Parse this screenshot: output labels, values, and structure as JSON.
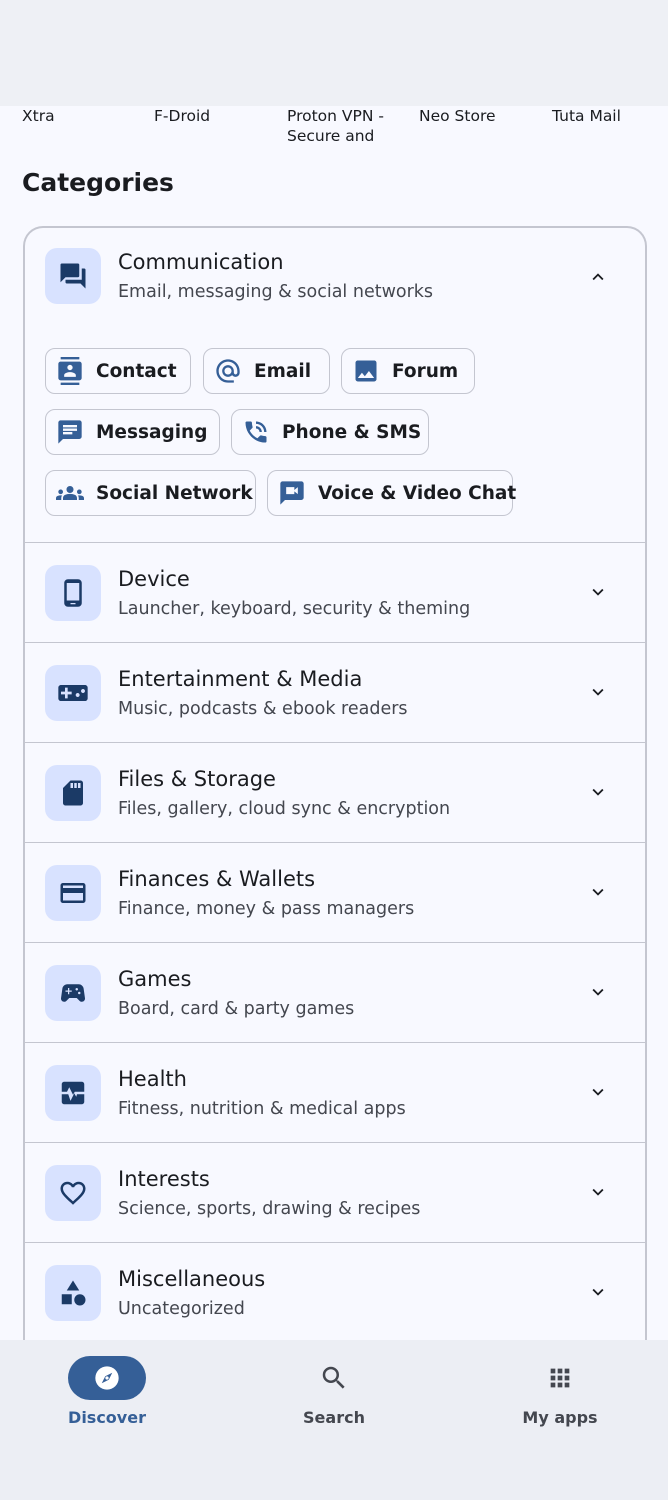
{
  "top_apps": [
    "Xtra",
    "F-Droid",
    "Proton VPN - Secure and",
    "Neo Store",
    "Tuta Mail"
  ],
  "section_title": "Categories",
  "communication": {
    "title": "Communication",
    "subtitle": "Email, messaging & social networks",
    "chips": [
      {
        "label": "Contact",
        "icon": "contact-icon"
      },
      {
        "label": "Email",
        "icon": "at-icon"
      },
      {
        "label": "Forum",
        "icon": "image-icon"
      },
      {
        "label": "Messaging",
        "icon": "message-icon"
      },
      {
        "label": "Phone & SMS",
        "icon": "phone-icon"
      },
      {
        "label": "Social Network",
        "icon": "group-icon"
      },
      {
        "label": "Voice & Video Chat",
        "icon": "video-chat-icon"
      }
    ]
  },
  "categories": [
    {
      "title": "Device",
      "subtitle": "Launcher, keyboard, security & theming",
      "icon": "phone-device-icon"
    },
    {
      "title": "Entertainment & Media",
      "subtitle": "Music, podcasts & ebook readers",
      "icon": "gamepad-icon"
    },
    {
      "title": "Files & Storage",
      "subtitle": "Files, gallery, cloud sync & encryption",
      "icon": "sd-card-icon"
    },
    {
      "title": "Finances & Wallets",
      "subtitle": "Finance, money & pass managers",
      "icon": "wallet-icon"
    },
    {
      "title": "Games",
      "subtitle": "Board, card & party games",
      "icon": "controller-icon"
    },
    {
      "title": "Health",
      "subtitle": "Fitness, nutrition & medical apps",
      "icon": "pulse-icon"
    },
    {
      "title": "Interests",
      "subtitle": "Science, sports, drawing & recipes",
      "icon": "heart-icon"
    },
    {
      "title": "Miscellaneous",
      "subtitle": "Uncategorized",
      "icon": "shapes-icon"
    }
  ],
  "nav": {
    "discover": "Discover",
    "search": "Search",
    "myapps": "My apps"
  },
  "colors": {
    "accent": "#355f97",
    "icon_bg": "#d8e2ff",
    "icon_fg": "#1b3a66"
  }
}
